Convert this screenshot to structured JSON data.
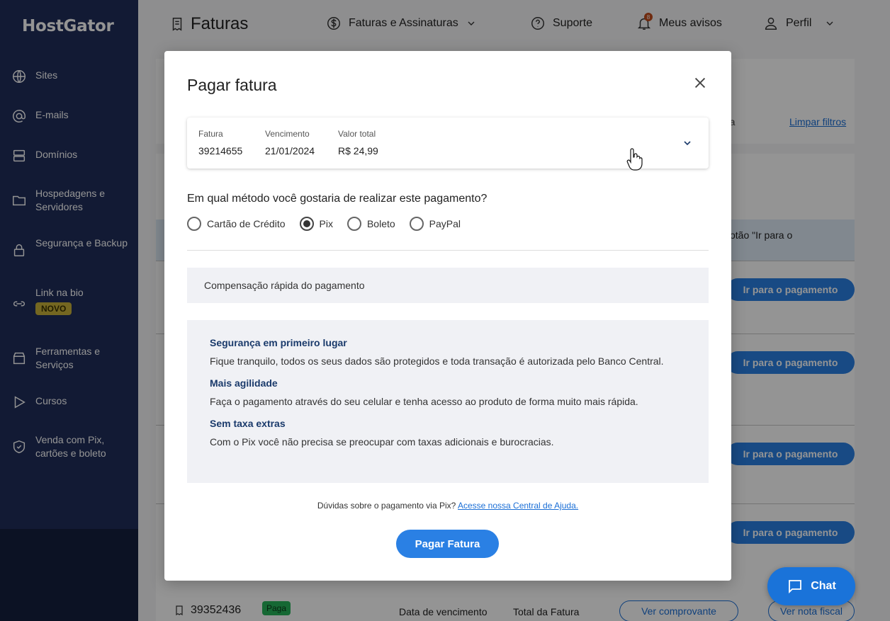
{
  "brand": "HostGator",
  "sidebar": {
    "items": [
      {
        "label": "Sites",
        "icon": "globe-icon"
      },
      {
        "label": "E-mails",
        "icon": "at-icon"
      },
      {
        "label": "Domínios",
        "icon": "server-icon"
      },
      {
        "label": "Hospedagens e Servidores",
        "icon": "folder-icon"
      },
      {
        "label": "Segurança e Backup",
        "icon": "lock-icon"
      },
      {
        "label": "Link na bio",
        "icon": "link-icon",
        "badge": "NOVO"
      },
      {
        "label": "Ferramentas e Serviços",
        "icon": "store-icon"
      },
      {
        "label": "Cursos",
        "icon": "play-icon"
      },
      {
        "label": "Venda com Pix, cartões e boleto",
        "icon": "shield-icon"
      }
    ]
  },
  "header": {
    "title": "Faturas",
    "menu_faturas": "Faturas e Assinaturas",
    "support": "Suporte",
    "notices": "Meus avisos",
    "notices_count": "8",
    "profile": "Perfil"
  },
  "background": {
    "search_fragment": "ra",
    "clear_filters": "Limpar filtros",
    "info_fragment": "otão \"Ir para o",
    "pay_label": "Ir para o pagamento",
    "bottom_row": {
      "invoice": "39352436",
      "status": "Paga",
      "due_label": "Data de vencimento",
      "total_label": "Total da Fatura",
      "receipt_button": "Ver comprovante",
      "nf_button": "Ver nota fiscal"
    }
  },
  "modal": {
    "title": "Pagar fatura",
    "invoice": {
      "number_label": "Fatura",
      "number": "39214655",
      "due_label": "Vencimento",
      "due": "21/01/2024",
      "total_label": "Valor total",
      "total": "R$ 24,99"
    },
    "question": "Em qual método você gostaria de realizar este pagamento?",
    "methods": [
      {
        "label": "Cartão de Crédito",
        "checked": false
      },
      {
        "label": "Pix",
        "checked": true
      },
      {
        "label": "Boleto",
        "checked": false
      },
      {
        "label": "PayPal",
        "checked": false
      }
    ],
    "compensation": "Compensação rápida do pagamento",
    "benefits": [
      {
        "title": "Segurança em primeiro lugar",
        "text": "Fique tranquilo, todos os seus dados são protegidos e toda transação é autorizada pelo Banco Central."
      },
      {
        "title": "Mais agilidade",
        "text": "Faça o pagamento através do seu celular e tenha acesso ao produto de forma muito mais rápida."
      },
      {
        "title": "Sem taxa extras",
        "text": "Com o Pix você não precisa se preocupar com taxas adicionais e burocracias."
      }
    ],
    "help_text": "Dúvidas sobre o pagamento via Pix?",
    "help_link": "Acesse nossa Central de Ajuda.",
    "submit": "Pagar Fatura"
  },
  "chat": {
    "label": "Chat"
  },
  "colors": {
    "primary": "#2a80e4",
    "sidebar": "#1f2d5a",
    "link": "#1b6fd6",
    "benefit_title": "#1a3a6b"
  }
}
